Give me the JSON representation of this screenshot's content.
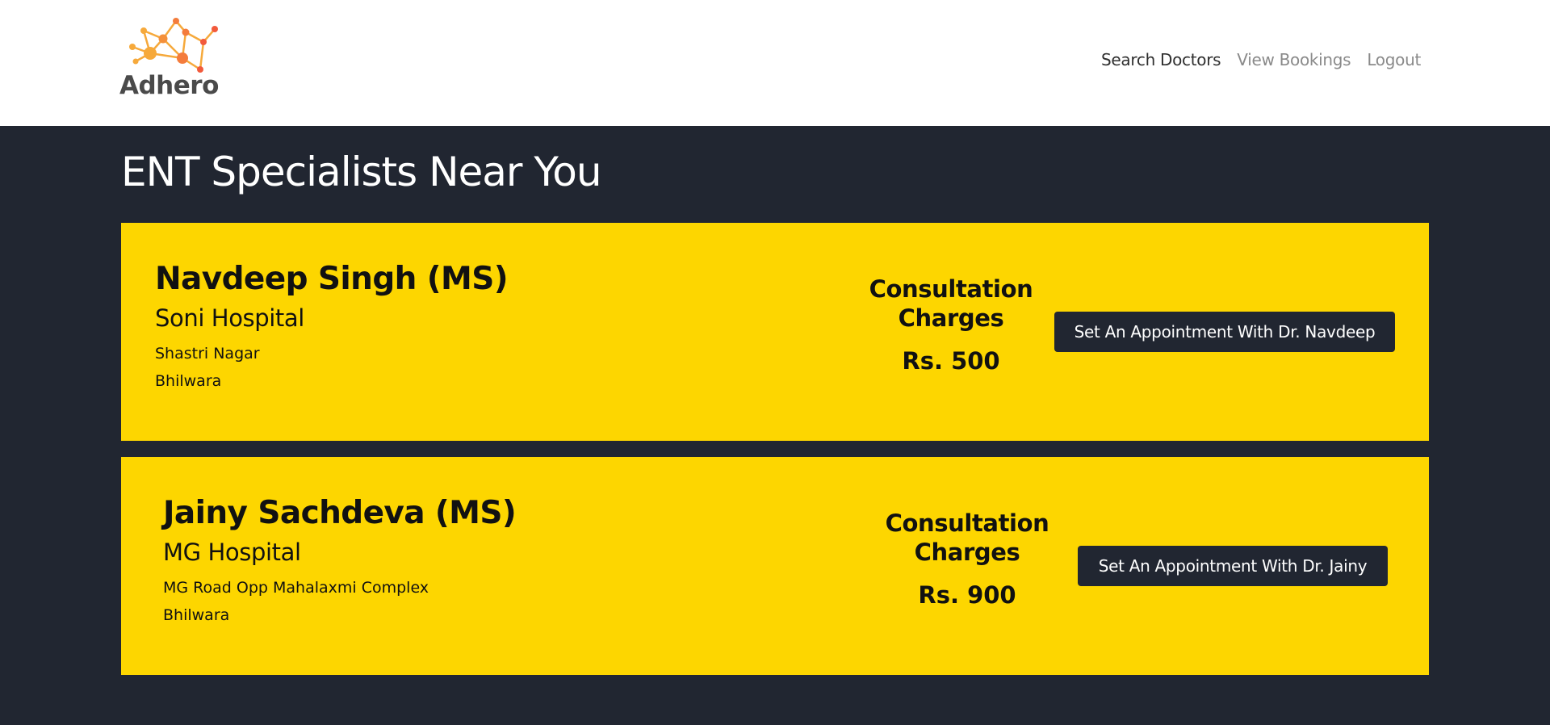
{
  "brand": {
    "name": "Adhero",
    "colors": {
      "primary": "#f47c3c",
      "secondary": "#f6a93b",
      "text": "#4a4a4a"
    }
  },
  "nav": {
    "links": [
      {
        "label": "Search Doctors",
        "active": true
      },
      {
        "label": "View Bookings",
        "active": false
      },
      {
        "label": "Logout",
        "active": false
      }
    ]
  },
  "page": {
    "title": "ENT Specialists Near You"
  },
  "doctors": [
    {
      "name": "Navdeep Singh (MS)",
      "hospital": "Soni Hospital",
      "address_line1": "Shastri Nagar",
      "address_line2": "Bhilwara",
      "charges_label": "Consultation Charges",
      "charges_value": "Rs. 500",
      "button_label": "Set An Appointment With Dr. Navdeep"
    },
    {
      "name": "Jainy Sachdeva (MS)",
      "hospital": "MG Hospital",
      "address_line1": "MG Road Opp Mahalaxmi Complex",
      "address_line2": "Bhilwara",
      "charges_label": "Consultation Charges",
      "charges_value": "Rs. 900",
      "button_label": "Set An Appointment With Dr. Jainy"
    }
  ],
  "theme": {
    "background": "#212631",
    "card": "#fdd600",
    "button": "#212631"
  }
}
